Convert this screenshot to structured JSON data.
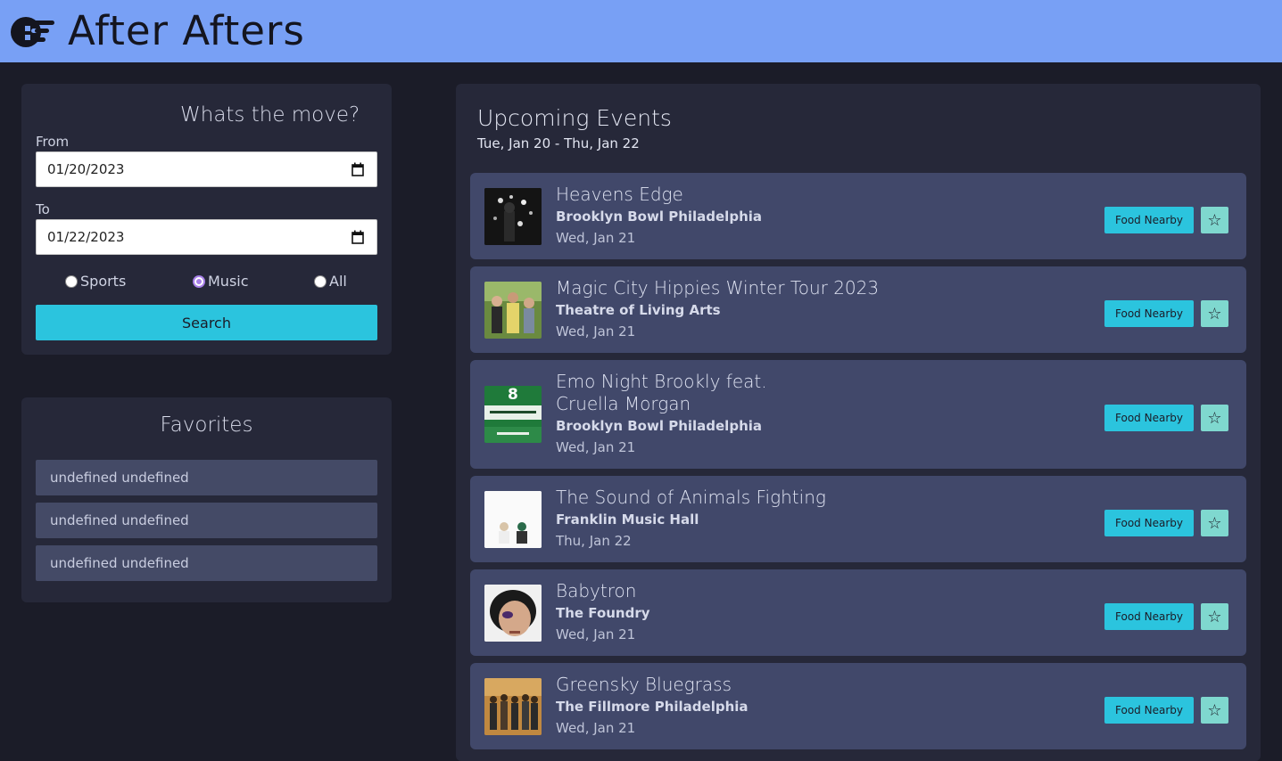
{
  "app": {
    "title": "After Afters",
    "logo_icon": "app-logo-icon"
  },
  "search": {
    "heading": "Whats the move?",
    "from_label": "From",
    "from_value": "01/20/2023",
    "to_label": "To",
    "to_value": "01/22/2023",
    "categories": [
      {
        "label": "Sports",
        "selected": false
      },
      {
        "label": "Music",
        "selected": true
      },
      {
        "label": "All",
        "selected": false
      }
    ],
    "button_label": "Search"
  },
  "favorites": {
    "heading": "Favorites",
    "items": [
      "undefined undefined",
      "undefined undefined",
      "undefined undefined"
    ]
  },
  "events": {
    "heading": "Upcoming Events",
    "range": "Tue, Jan 20 - Thu, Jan 22",
    "food_label": "Food Nearby",
    "star_glyph": "☆",
    "items": [
      {
        "name": "Heavens Edge",
        "venue": "Brooklyn Bowl Philadelphia",
        "date": "Wed, Jan 21"
      },
      {
        "name": "Magic City Hippies Winter Tour 2023",
        "venue": "Theatre of Living Arts",
        "date": "Wed, Jan 21"
      },
      {
        "name": "Emo Night Brookly feat. Cruella Morgan",
        "venue": "Brooklyn Bowl Philadelphia",
        "date": "Wed, Jan 21",
        "thumb_text": "8"
      },
      {
        "name": "The Sound of Animals Fighting",
        "venue": "Franklin Music Hall",
        "date": "Thu, Jan 22"
      },
      {
        "name": "Babytron",
        "venue": "The Foundry",
        "date": "Wed, Jan 21"
      },
      {
        "name": "Greensky Bluegrass",
        "venue": "The Fillmore Philadelphia",
        "date": "Wed, Jan 21"
      }
    ]
  },
  "colors": {
    "header": "#78a0f5",
    "accent": "#2bc4de",
    "star": "#7fd8cf",
    "card": "#41486a",
    "panel": "#262839"
  }
}
